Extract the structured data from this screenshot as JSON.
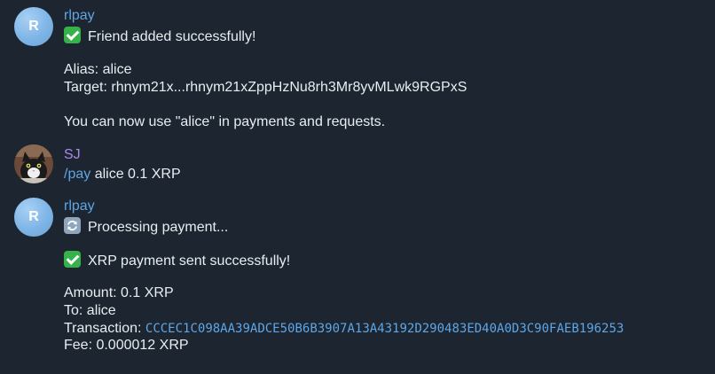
{
  "messages": [
    {
      "sender": "rlpay",
      "avatar_letter": "R",
      "lines": {
        "success": "Friend added successfully!",
        "alias": "Alias: alice",
        "target": "Target: rhnym21x...rhnym21xZppHzNu8rh3Mr8yvMLwk9RGPxS",
        "hint": "You can now use \"alice\" in payments and requests."
      }
    },
    {
      "sender": "SJ",
      "command": "/pay",
      "args": " alice 0.1 XRP"
    },
    {
      "sender": "rlpay",
      "avatar_letter": "R",
      "lines": {
        "processing": "Processing payment...",
        "success": "XRP payment sent successfully!",
        "amount": "Amount: 0.1 XRP",
        "to": "To: alice",
        "transaction_label": "Transaction: ",
        "transaction_hash": "CCCEC1C098AA39ADCE50B6B3907A13A43192D290483ED40A0D3C90FAEB196253",
        "fee": "Fee: 0.000012 XRP"
      }
    }
  ],
  "colors": {
    "background": "#1c2530",
    "bot_name": "#5ea6e6",
    "user_name": "#a98ae6",
    "link": "#5ea6e6",
    "text": "#e9edf1",
    "check_emoji": "#35b34a"
  },
  "icons": {
    "check": "white-heavy-check-mark-icon",
    "processing": "counterclockwise-arrows-icon"
  }
}
